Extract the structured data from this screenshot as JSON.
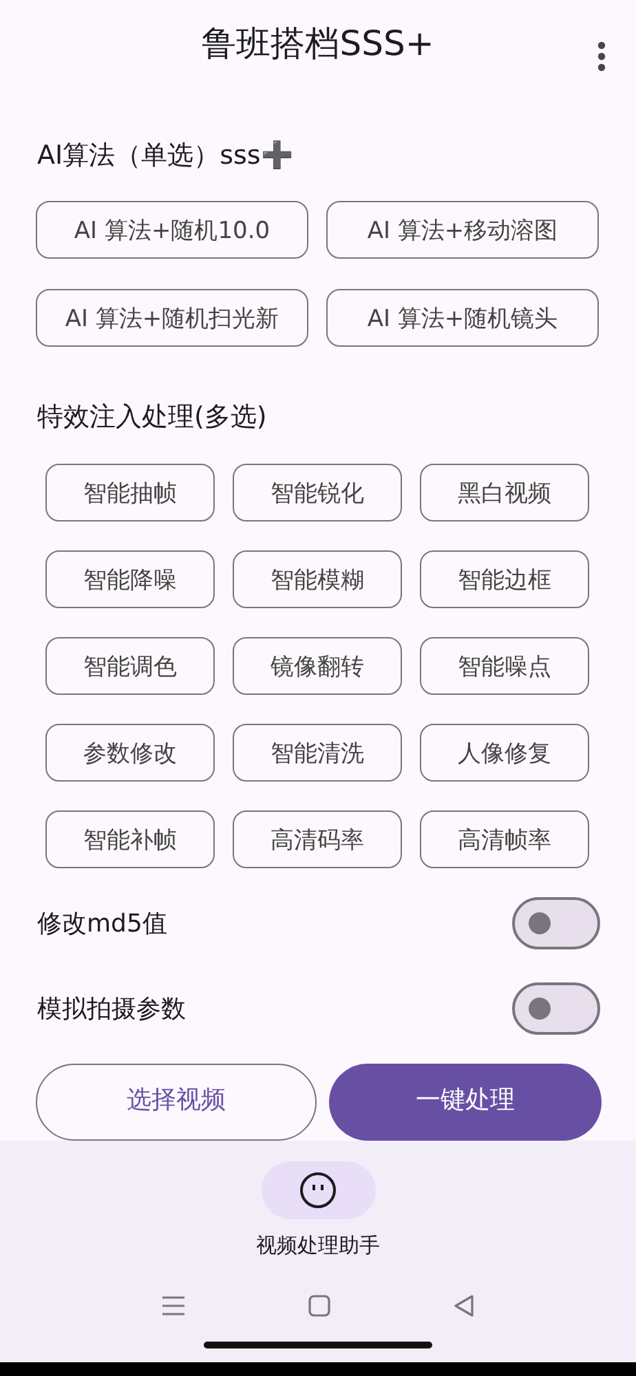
{
  "app_bar": {
    "title": "鲁班搭档SSS+"
  },
  "ai_section": {
    "title": "AI算法（单选）sss➕",
    "options": [
      {
        "label": "AI 算法+随机10.0",
        "selected": false
      },
      {
        "label": "AI 算法+移动溶图",
        "selected": false
      },
      {
        "label": "AI 算法+随机扫光新",
        "selected": false
      },
      {
        "label": "AI 算法+随机镜头",
        "selected": false
      }
    ]
  },
  "effects_section": {
    "title": "特效注入处理(多选)",
    "options": [
      {
        "label": "智能抽帧",
        "selected": false
      },
      {
        "label": "智能锐化",
        "selected": false
      },
      {
        "label": "黑白视频",
        "selected": false
      },
      {
        "label": "智能降噪",
        "selected": false
      },
      {
        "label": "智能模糊",
        "selected": false
      },
      {
        "label": "智能边框",
        "selected": false
      },
      {
        "label": "智能调色",
        "selected": false
      },
      {
        "label": "镜像翻转",
        "selected": false
      },
      {
        "label": "智能噪点",
        "selected": false
      },
      {
        "label": "参数修改",
        "selected": false
      },
      {
        "label": "智能清洗",
        "selected": false
      },
      {
        "label": "人像修复",
        "selected": false
      },
      {
        "label": "智能补帧",
        "selected": false
      },
      {
        "label": "高清码率",
        "selected": false
      },
      {
        "label": "高清帧率",
        "selected": false
      }
    ]
  },
  "switches": [
    {
      "label": "修改md5值",
      "on": false
    },
    {
      "label": "模拟拍摄参数",
      "on": false
    }
  ],
  "actions": [
    {
      "label": "选择视频",
      "kind": "outlined"
    },
    {
      "label": "一键处理",
      "kind": "filled"
    }
  ],
  "bottom_nav": {
    "items": [
      {
        "label": "视频处理助手",
        "selected": true
      }
    ]
  }
}
